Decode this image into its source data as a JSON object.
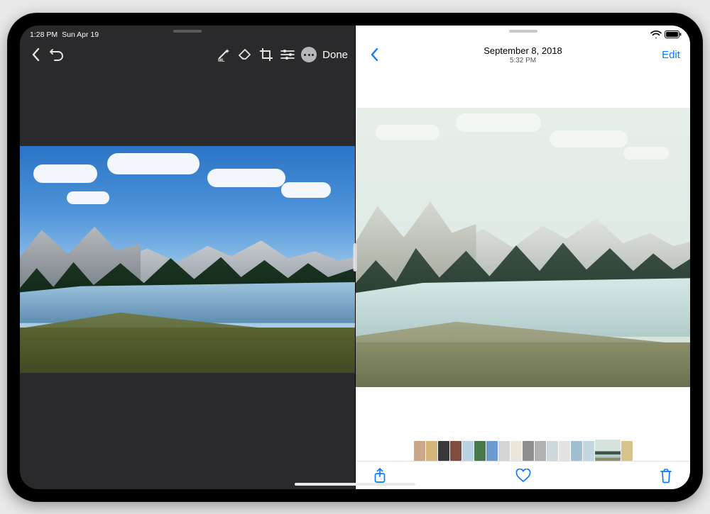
{
  "status": {
    "time": "1:28 PM",
    "date": "Sun Apr 19"
  },
  "left": {
    "done_label": "Done"
  },
  "right": {
    "title_date": "September 8, 2018",
    "title_time": "5:32 PM",
    "edit_label": "Edit"
  },
  "thumbs": [
    "#caa68a",
    "#d6b67a",
    "#383838",
    "#7e4d3e",
    "#b9d3e3",
    "#4a784d",
    "#6a9ad0",
    "#d4d4d4",
    "#eae6da",
    "#8e8e8e",
    "#b0b0b0",
    "#cfd8dc",
    "#e2e2e2",
    "#a2bfd1",
    "#c4d7e0",
    "#7aa3bd",
    "#d9c38d"
  ]
}
